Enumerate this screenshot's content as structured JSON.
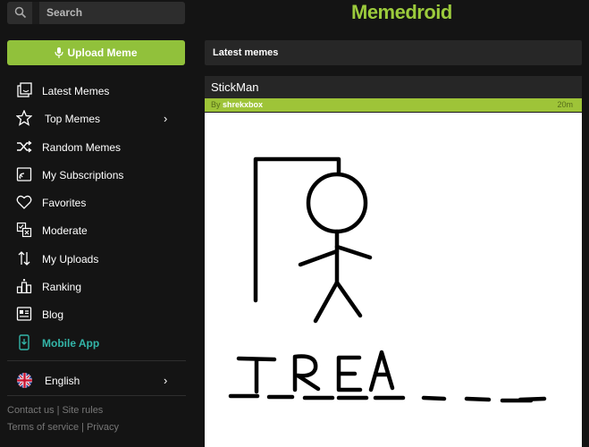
{
  "header": {
    "search_placeholder": "Search",
    "logo": "Memedroid"
  },
  "sidebar": {
    "upload_label": "Upload Meme",
    "items": [
      {
        "label": "Latest Memes",
        "icon": "latest-icon"
      },
      {
        "label": "Top Memes",
        "icon": "star-icon",
        "has_submenu": true
      },
      {
        "label": "Random Memes",
        "icon": "shuffle-icon"
      },
      {
        "label": "My Subscriptions",
        "icon": "subscriptions-icon"
      },
      {
        "label": "Favorites",
        "icon": "heart-icon"
      },
      {
        "label": "Moderate",
        "icon": "moderate-icon"
      },
      {
        "label": "My Uploads",
        "icon": "uploads-icon"
      },
      {
        "label": "Ranking",
        "icon": "ranking-icon"
      },
      {
        "label": "Blog",
        "icon": "blog-icon"
      },
      {
        "label": "Mobile App",
        "icon": "mobile-icon"
      }
    ],
    "language": "English",
    "footer": {
      "contact": "Contact us",
      "site_rules": "Site rules",
      "terms": "Terms of service",
      "privacy": "Privacy"
    }
  },
  "main": {
    "section_title": "Latest memes",
    "post": {
      "title": "StickMan",
      "by_prefix": "By",
      "author": "shrekxbox",
      "age": "20m",
      "image_text": "TREA"
    }
  },
  "colors": {
    "accent": "#91c13b",
    "logo": "#9ccb3c",
    "mobile_app": "#33b5a8",
    "background": "#141414"
  }
}
